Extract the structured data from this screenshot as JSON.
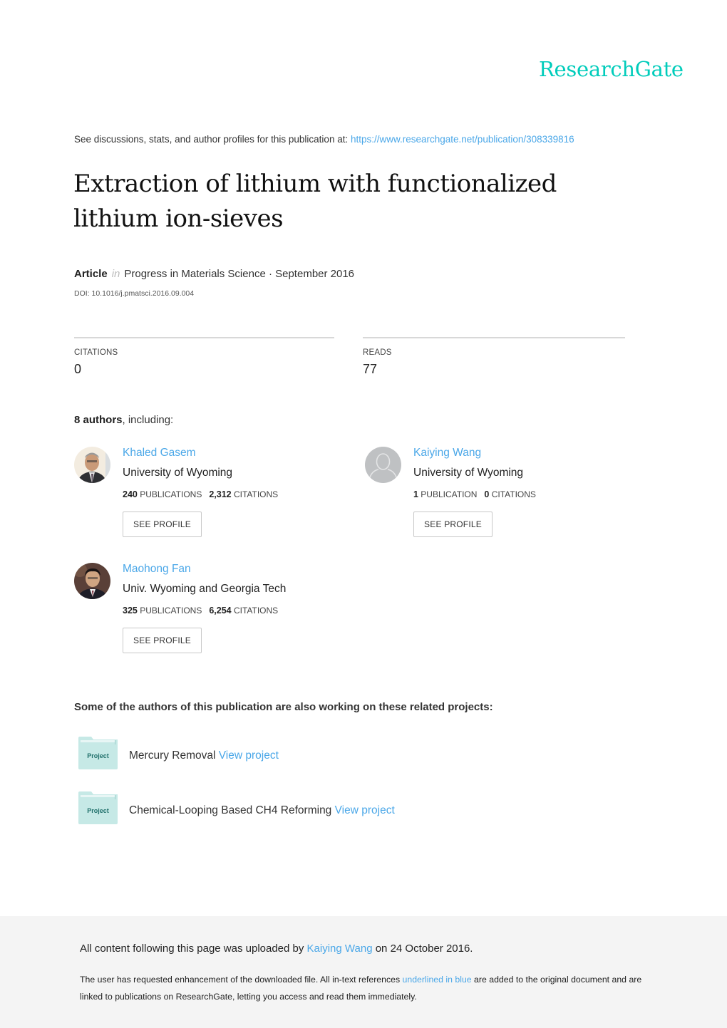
{
  "brand": {
    "logo_text": "ResearchGate",
    "accent_color": "#00ccbb",
    "link_color": "#4aa7e8"
  },
  "header": {
    "see_discussions_text": "See discussions, stats, and author profiles for this publication at: ",
    "publication_url": "https://www.researchgate.net/publication/308339816"
  },
  "publication": {
    "title": "Extraction of lithium with functionalized lithium ion-sieves",
    "type": "Article",
    "in_word": "in",
    "journal_date": "Progress in Materials Science · September 2016",
    "doi": "DOI: 10.1016/j.pmatsci.2016.09.004"
  },
  "stats": {
    "citations_label": "CITATIONS",
    "citations_value": "0",
    "reads_label": "READS",
    "reads_value": "77"
  },
  "authors_section": {
    "count_text": "8 authors",
    "suffix": ", including:",
    "see_profile_label": "SEE PROFILE",
    "authors": [
      {
        "name": "Khaled Gasem",
        "institution": "University of Wyoming",
        "publications": "240",
        "publications_label": "PUBLICATIONS",
        "citations": "2,312",
        "citations_label": "CITATIONS",
        "avatar": "photo-avatar"
      },
      {
        "name": "Kaiying Wang",
        "institution": "University of Wyoming",
        "publications": "1",
        "publications_label": "PUBLICATION",
        "citations": "0",
        "citations_label": "CITATIONS",
        "avatar": "default-avatar"
      },
      {
        "name": "Maohong Fan",
        "institution": "Univ. Wyoming and Georgia Tech",
        "publications": "325",
        "publications_label": "PUBLICATIONS",
        "citations": "6,254",
        "citations_label": "CITATIONS",
        "avatar": "photo-avatar"
      }
    ]
  },
  "projects_section": {
    "heading": "Some of the authors of this publication are also working on these related projects:",
    "folder_label": "Project",
    "view_label": "View project",
    "projects": [
      {
        "name": "Mercury Removal "
      },
      {
        "name": "Chemical-Looping Based CH4 Reforming "
      }
    ]
  },
  "footer": {
    "uploaded_prefix": "All content following this page was uploaded by ",
    "uploader": "Kaiying Wang",
    "uploaded_suffix": " on 24 October 2016.",
    "note_part1": "The user has requested enhancement of the downloaded file. All in-text references ",
    "note_link": "underlined in blue",
    "note_part2": " are added to the original document and are linked to publications on ResearchGate, letting you access and read them immediately."
  }
}
